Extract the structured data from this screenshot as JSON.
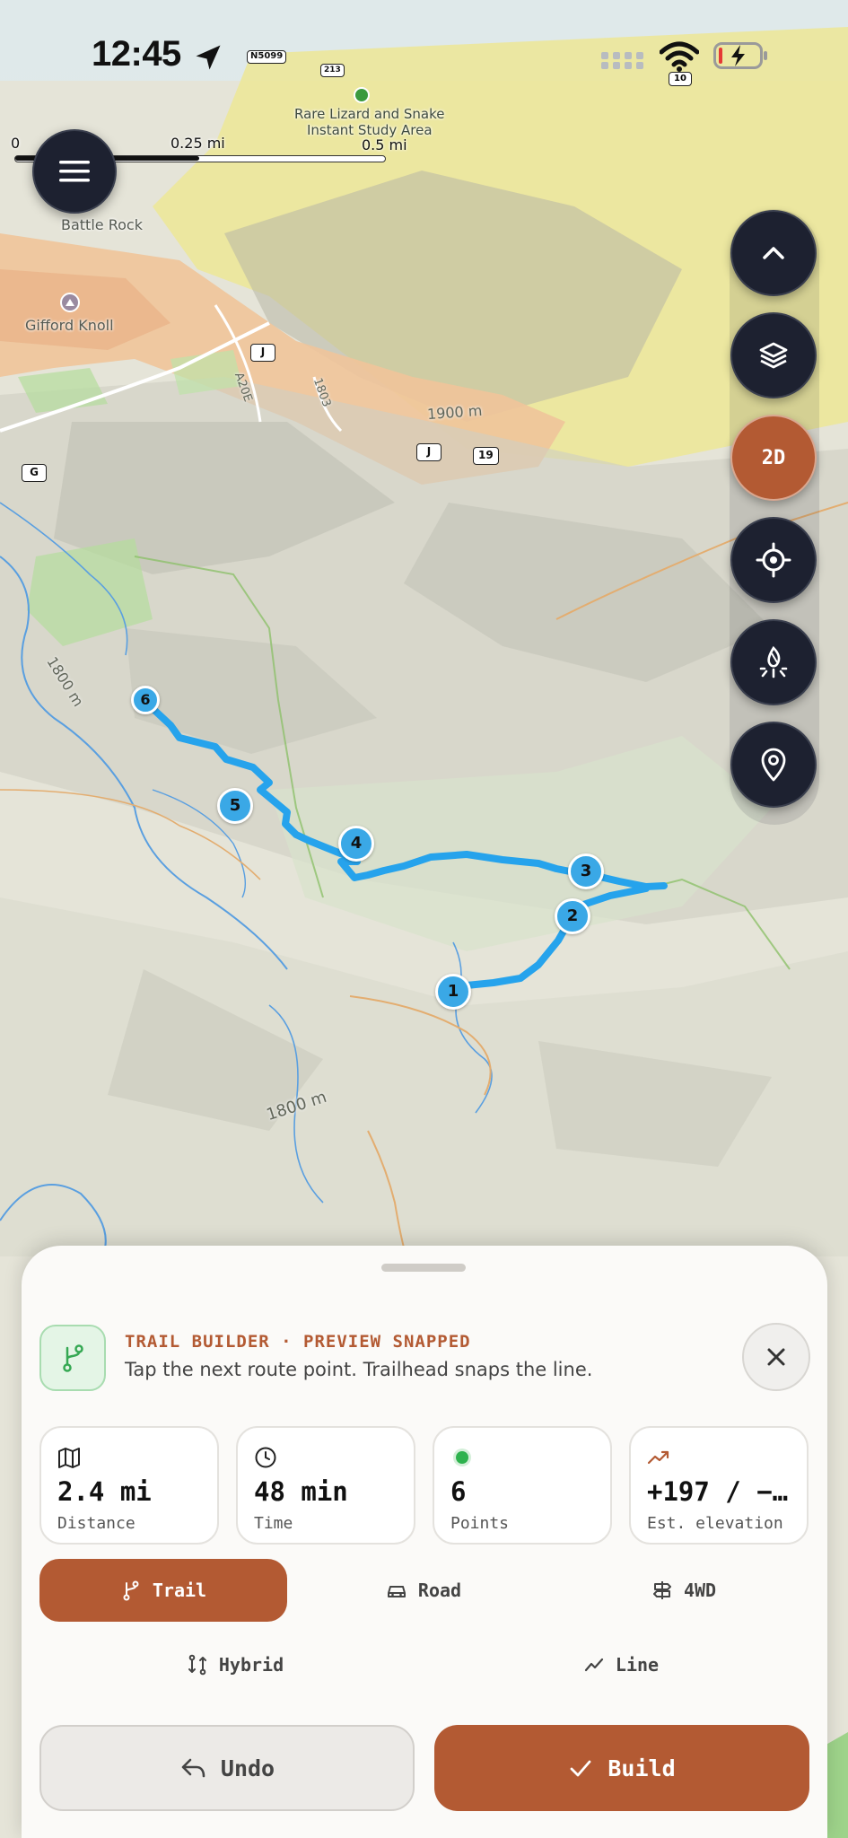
{
  "status_bar": {
    "time": "12:45",
    "location_icon": "location-arrow-icon",
    "route_shield": "N5099",
    "wifi_badge": "10"
  },
  "map": {
    "poi": {
      "name": "Rare Lizard and Snake Instant Study Area",
      "line1": "Rare Lizard and Snake",
      "line2": "Instant Study Area"
    },
    "peaks": [
      "Battle Rock",
      "Gifford Knoll"
    ],
    "shields": [
      "213",
      "J",
      "J",
      "19",
      "G"
    ],
    "road_labels": [
      "A20E",
      "1803"
    ],
    "contours": [
      "1900 m",
      "1800 m",
      "1800 m"
    ],
    "waypoints": [
      "1",
      "2",
      "3",
      "4",
      "5",
      "6"
    ],
    "route_color": "#26a3ec",
    "waypoint_color": "#3aa8e6"
  },
  "scale": {
    "zero": "0",
    "quarter": "0.25 mi",
    "half": "0.5 mi"
  },
  "controls": {
    "menu_icon": "hamburger-menu-icon",
    "collapse_icon": "chevron-up-icon",
    "layers_icon": "layers-icon",
    "mode_toggle": "2D",
    "locate_icon": "crosshair-icon",
    "campfire_icon": "campfire-icon",
    "pin_icon": "map-pin-icon"
  },
  "sheet": {
    "title": "TRAIL BUILDER · PREVIEW SNAPPED",
    "subtitle": "Tap the next route point. Trailhead snaps the line.",
    "stats": [
      {
        "icon": "map-icon",
        "value": "2.4 mi",
        "label": "Distance"
      },
      {
        "icon": "clock-icon",
        "value": "48 min",
        "label": "Time"
      },
      {
        "icon": "green-dot-icon",
        "value": "6",
        "label": "Points"
      },
      {
        "icon": "trend-up-icon",
        "value": "+197 / −…",
        "label": "Est. elevation"
      }
    ],
    "modes": [
      {
        "icon": "trail-branch-icon",
        "label": "Trail",
        "active": true
      },
      {
        "icon": "car-icon",
        "label": "Road",
        "active": false
      },
      {
        "icon": "signpost-icon",
        "label": "4WD",
        "active": false
      },
      {
        "icon": "hybrid-route-icon",
        "label": "Hybrid",
        "active": false
      },
      {
        "icon": "line-chart-icon",
        "label": "Line",
        "active": false
      }
    ],
    "undo_label": "Undo",
    "build_label": "Build"
  },
  "colors": {
    "accent": "#b35a33",
    "control_bg": "#1d2130",
    "route": "#26a3ec"
  }
}
